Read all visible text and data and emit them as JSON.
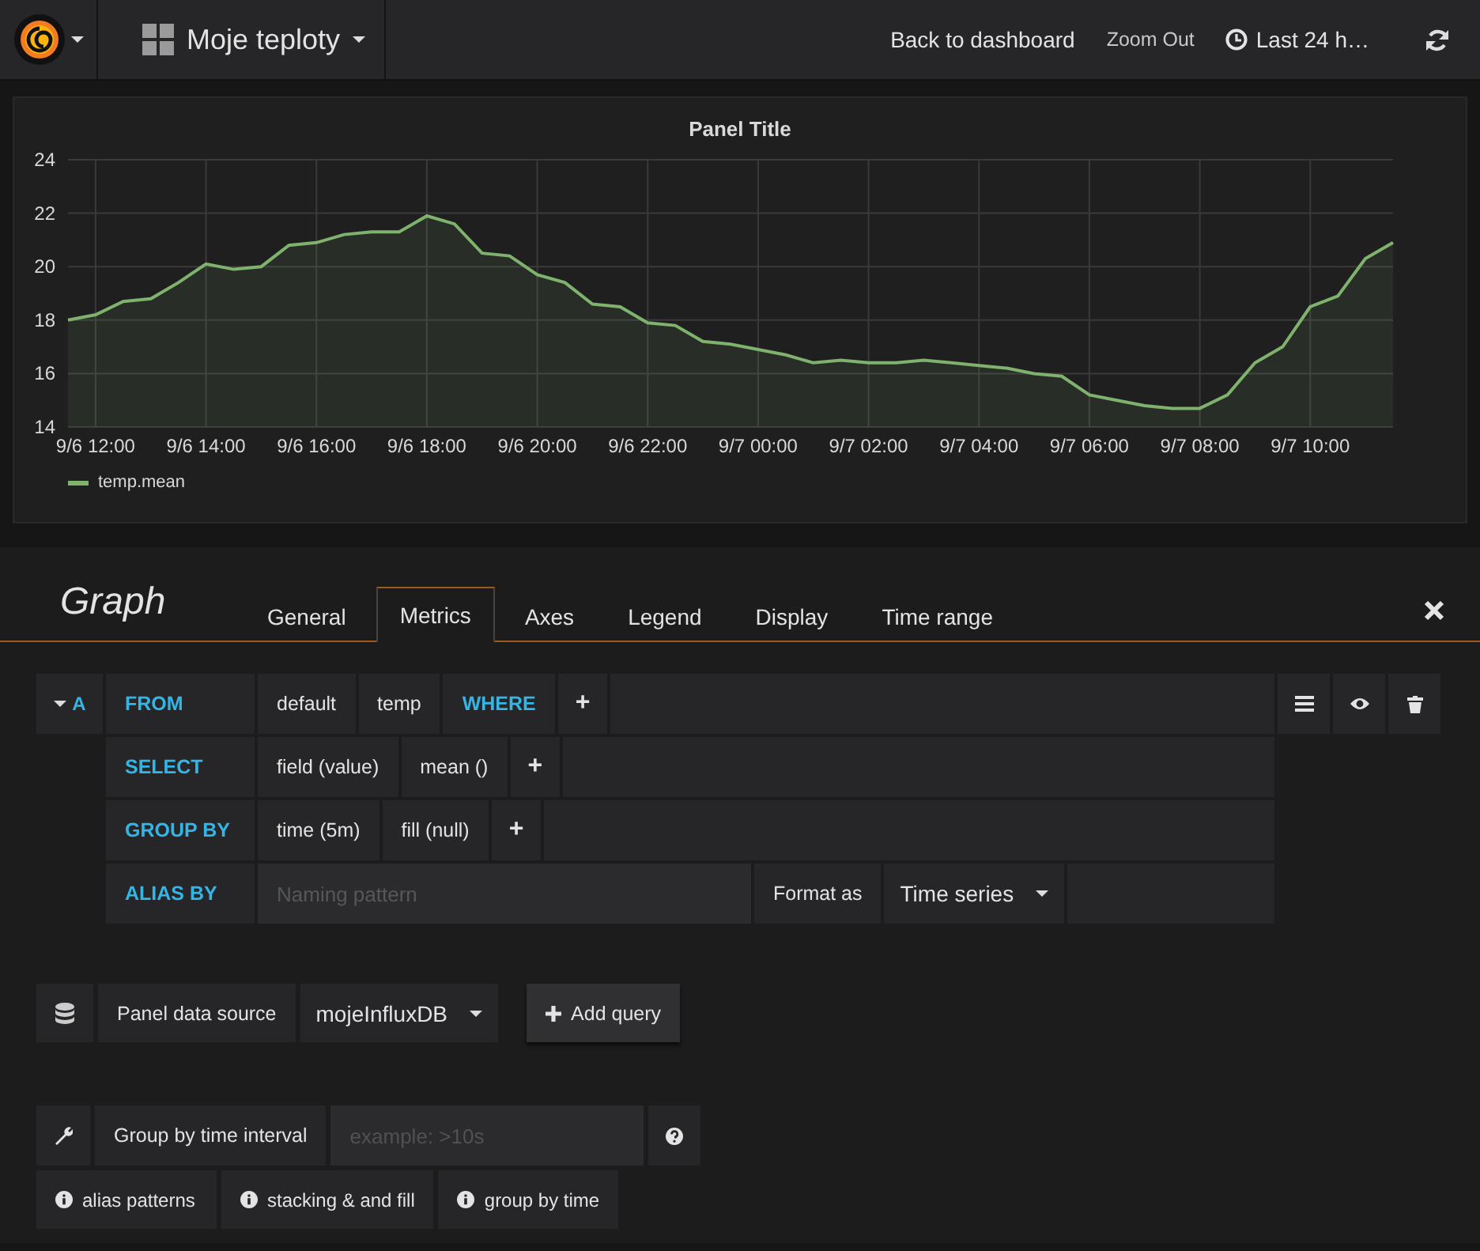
{
  "topbar": {
    "dashboard_title": "Moje teploty",
    "back": "Back to dashboard",
    "zoom_out": "Zoom Out",
    "time_range": "Last 24 h…"
  },
  "panel": {
    "title": "Panel Title",
    "chart_data": {
      "type": "area",
      "grid": true,
      "categories": [
        null,
        "9/6 12:00",
        null,
        null,
        null,
        "9/6 14:00",
        null,
        null,
        null,
        "9/6 16:00",
        null,
        null,
        null,
        "9/6 18:00",
        null,
        null,
        null,
        "9/6 20:00",
        null,
        null,
        null,
        "9/6 22:00",
        null,
        null,
        null,
        "9/7 00:00",
        null,
        null,
        null,
        "9/7 02:00",
        null,
        null,
        null,
        "9/7 04:00",
        null,
        null,
        null,
        "9/7 06:00",
        null,
        null,
        null,
        "9/7 08:00",
        null,
        null,
        null,
        "9/7 10:00",
        null,
        null,
        null
      ],
      "series": [
        {
          "name": "temp.mean",
          "color": "#7eb26d",
          "values": [
            18.0,
            18.2,
            18.7,
            18.8,
            19.4,
            20.1,
            19.9,
            20.0,
            20.8,
            20.9,
            21.2,
            21.3,
            21.3,
            21.9,
            21.6,
            20.5,
            20.4,
            19.7,
            19.4,
            18.6,
            18.5,
            17.9,
            17.8,
            17.2,
            17.1,
            16.9,
            16.7,
            16.4,
            16.5,
            16.4,
            16.4,
            16.5,
            16.4,
            16.3,
            16.2,
            16.0,
            15.9,
            15.2,
            15.0,
            14.8,
            14.7,
            14.7,
            15.2,
            16.4,
            17.0,
            18.5,
            18.9,
            20.3,
            20.9
          ]
        }
      ],
      "ylim": [
        14,
        24
      ],
      "yticks": [
        14,
        16,
        18,
        20,
        22,
        24
      ]
    }
  },
  "editor": {
    "title": "Graph",
    "tabs": [
      {
        "label": "General",
        "selected": false
      },
      {
        "label": "Metrics",
        "selected": true
      },
      {
        "label": "Axes",
        "selected": false
      },
      {
        "label": "Legend",
        "selected": false
      },
      {
        "label": "Display",
        "selected": false
      },
      {
        "label": "Time range",
        "selected": false
      }
    ]
  },
  "query": {
    "ref_id": "A",
    "expanded": true,
    "rows": [
      {
        "keyword": "FROM",
        "parts": [
          {
            "kind": "value",
            "text": "default"
          },
          {
            "kind": "value",
            "text": "temp"
          },
          {
            "kind": "keyword",
            "text": "WHERE"
          },
          {
            "kind": "add",
            "text": "+"
          }
        ]
      },
      {
        "keyword": "SELECT",
        "parts": [
          {
            "kind": "value",
            "text": "field (value)"
          },
          {
            "kind": "value",
            "text": "mean ()"
          },
          {
            "kind": "add",
            "text": "+"
          }
        ]
      },
      {
        "keyword": "GROUP BY",
        "parts": [
          {
            "kind": "value",
            "text": "time (5m)"
          },
          {
            "kind": "value",
            "text": "fill (null)"
          },
          {
            "kind": "add",
            "text": "+"
          }
        ]
      },
      {
        "keyword": "ALIAS BY",
        "parts": [
          {
            "kind": "input",
            "placeholder": "Naming pattern"
          },
          {
            "kind": "label",
            "text": "Format as"
          },
          {
            "kind": "select",
            "text": "Time series"
          }
        ]
      }
    ]
  },
  "datasource": {
    "label": "Panel data source",
    "value": "mojeInfluxDB",
    "add_button": "Add query"
  },
  "options": {
    "interval_label": "Group by time interval",
    "interval_placeholder": "example: >10s",
    "help": [
      "alias patterns",
      "stacking & and fill",
      "group by time"
    ]
  }
}
